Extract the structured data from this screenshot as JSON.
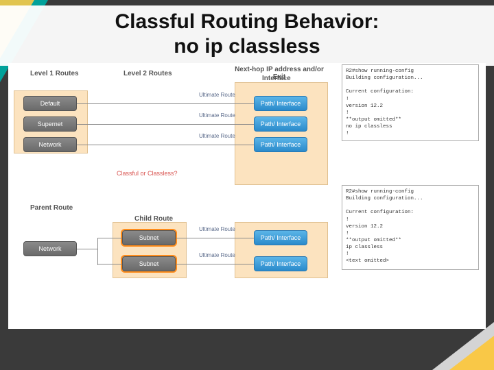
{
  "title_line1": "Classful Routing Behavior:",
  "title_line2": "no ip classless",
  "headers": {
    "l1": "Level 1 Routes",
    "l2": "Level 2 Routes",
    "nh1": "Next-hop IP address and/or Exit",
    "nh2": "Interface"
  },
  "prompt": "Classful or Classless?",
  "ultimate": "Ultimate Route",
  "l1boxes": {
    "default": "Default",
    "supernet": "Supernet",
    "network": "Network"
  },
  "parent": "Parent Route",
  "parentNet": "Network",
  "child": "Child Route",
  "subnet": "Subnet",
  "pi": "Path/ Interface",
  "term1": {
    "l0": "R2#show running-config",
    "l1": "Building configuration...",
    "l2": "",
    "l3": "Current configuration:",
    "l4": "!",
    "l5": "version 12.2",
    "l6": "!",
    "l7": "**output omitted**",
    "l8": "no ip classless",
    "l9": "!"
  },
  "term2": {
    "l0": "R2#show running-config",
    "l1": "Building configuration...",
    "l2": "",
    "l3": "Current configuration:",
    "l4": "!",
    "l5": "version 12.2",
    "l6": "!",
    "l7": "**output omitted**",
    "l8": "ip classless",
    "l9": "!",
    "l10": "<text omitted>"
  }
}
